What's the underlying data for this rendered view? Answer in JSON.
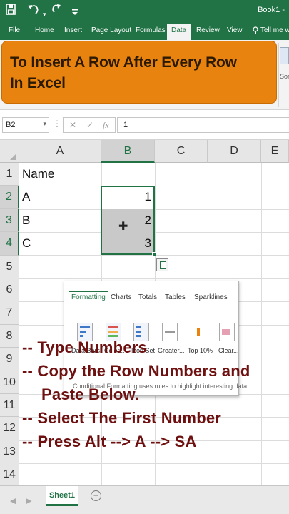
{
  "titlebar": {
    "save_icon": "save-icon",
    "undo_icon": "undo-icon",
    "workbook_name": "Book1 -"
  },
  "tabs": [
    {
      "label": "File"
    },
    {
      "label": "Home"
    },
    {
      "label": "Insert"
    },
    {
      "label": "Page Layout"
    },
    {
      "label": "Formulas"
    },
    {
      "label": "Data"
    },
    {
      "label": "Review"
    },
    {
      "label": "View"
    },
    {
      "label": "Tell me wh"
    }
  ],
  "active_tab": "Data",
  "banner": {
    "line1": "To Insert A Row After Every Row",
    "line2": "In Excel"
  },
  "ribbon_right": {
    "label": "Sor"
  },
  "formula_bar": {
    "name_box": "B2",
    "cancel": "✕",
    "enter": "✓",
    "fx": "fx",
    "value": "1"
  },
  "columns": [
    "A",
    "B",
    "C",
    "D",
    "E"
  ],
  "rows": [
    "1",
    "2",
    "3",
    "4",
    "5",
    "6",
    "7",
    "8",
    "9",
    "10",
    "11",
    "12",
    "13",
    "14"
  ],
  "cells": {
    "a1": "Name",
    "a2": "A",
    "a3": "B",
    "a4": "C",
    "b2": "1",
    "b3": "2",
    "b4": "3"
  },
  "quick_analysis": {
    "tabs": [
      "Formatting",
      "Charts",
      "Totals",
      "Tables",
      "Sparklines"
    ],
    "options": [
      "Data Bars",
      "Color...",
      "Icon Set",
      "Greater...",
      "Top 10%",
      "Clear..."
    ],
    "help": "Conditional Formatting uses rules to highlight interesting data."
  },
  "instructions": [
    "-- Type Numbers",
    "-- Copy the Row Numbers and",
    "Paste Below.",
    "-- Select The First Number",
    "-- Press Alt --> A --> SA"
  ],
  "sheets": {
    "active": "Sheet1",
    "add": "+"
  },
  "colors": {
    "excel_green": "#217346",
    "banner": "#e8830f",
    "instruction_text": "#6e1010"
  }
}
